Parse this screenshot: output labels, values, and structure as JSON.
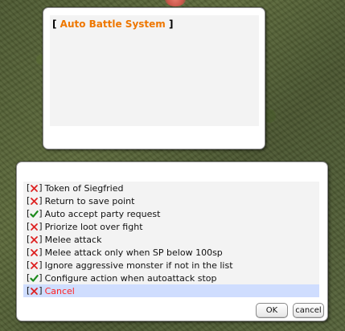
{
  "message_window": {
    "open_bracket": "[",
    "title": "Auto Battle System",
    "close_bracket": "]"
  },
  "menu": {
    "items": [
      {
        "label": "Token of Siegfried",
        "state": "off"
      },
      {
        "label": "Return to save point",
        "state": "off"
      },
      {
        "label": "Auto accept party request",
        "state": "on"
      },
      {
        "label": "Priorize loot over fight",
        "state": "off"
      },
      {
        "label": "Melee attack",
        "state": "off"
      },
      {
        "label": "Melee attack only when SP below 100sp",
        "state": "off"
      },
      {
        "label": "Ignore aggressive monster if not in the list",
        "state": "off"
      },
      {
        "label": "Configure action when autoattack stop",
        "state": "on"
      },
      {
        "label": "Cancel",
        "state": "off"
      }
    ],
    "selected_index": 8
  },
  "buttons": {
    "ok_label": "OK",
    "cancel_label": "cancel"
  },
  "colors": {
    "title": "#ee7700",
    "cross": "#dd2222",
    "check": "#1c8a1c",
    "cancel_text": "#ff2222",
    "selected_row": "#cfddfe"
  },
  "icons": {
    "off": "cross-icon",
    "on": "check-icon"
  }
}
